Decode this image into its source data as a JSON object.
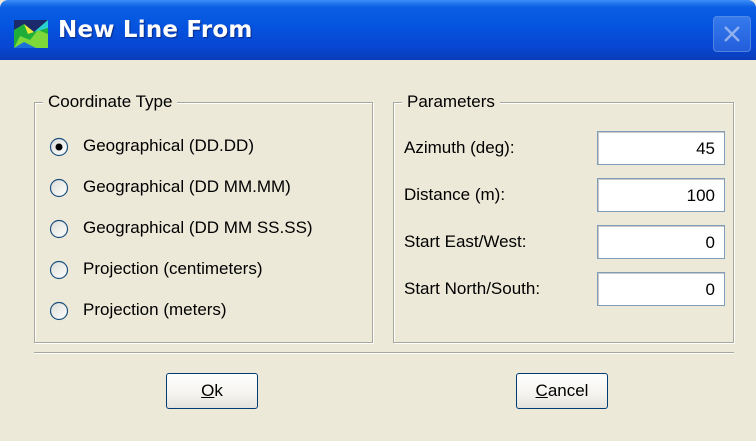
{
  "window": {
    "title": "New Line From",
    "icon": "terrain-map-icon",
    "close_icon": "close-icon"
  },
  "coordinate_type": {
    "group_label": "Coordinate Type",
    "options": [
      {
        "label": "Geographical (DD.DD)",
        "selected": true
      },
      {
        "label": "Geographical (DD MM.MM)",
        "selected": false
      },
      {
        "label": "Geographical (DD MM SS.SS)",
        "selected": false
      },
      {
        "label": "Projection (centimeters)",
        "selected": false
      },
      {
        "label": "Projection (meters)",
        "selected": false
      }
    ]
  },
  "parameters": {
    "group_label": "Parameters",
    "fields": [
      {
        "label": "Azimuth (deg):",
        "value": "45"
      },
      {
        "label": "Distance (m):",
        "value": "100"
      },
      {
        "label": "Start East/West:",
        "value": "0"
      },
      {
        "label": "Start North/South:",
        "value": "0"
      }
    ]
  },
  "buttons": {
    "ok_mnemonic": "O",
    "ok_rest": "k",
    "cancel_mnemonic": "C",
    "cancel_rest": "ancel"
  },
  "colors": {
    "titlebar": "#0553df",
    "dialog_bg": "#ece9d8",
    "button_border": "#003c74"
  }
}
